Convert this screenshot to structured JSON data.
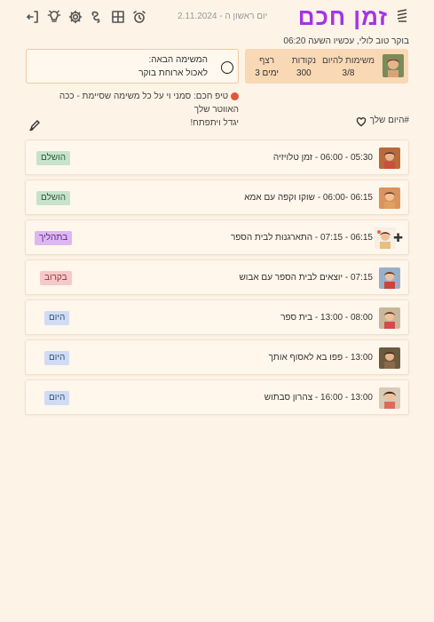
{
  "header": {
    "logo": "זמן חכם",
    "date": "יום ראשון ה - 2.11.2024",
    "greeting": "בוקר טוב לולי, עכשיו השעה 06:20",
    "icons": [
      "logout-icon",
      "lightbulb-icon",
      "gear-icon",
      "puzzle-icon",
      "grid-icon",
      "alarm-clock-icon"
    ]
  },
  "stats": {
    "tasks_label": "משימות להיום",
    "tasks_value": "3/8",
    "points_label": "נקודות",
    "points_value": "300",
    "streak_label": "רצף",
    "streak_value": "3 ימים"
  },
  "next_task": {
    "label": "המשימה הבאה:",
    "value": "לאכול ארוחת בוקר"
  },
  "tip": {
    "line1": "טיפ חכם: סמני וי על כל משימה שסיימת - ככה האווטר שלך",
    "line2": "יגדל ויתפתח!"
  },
  "day": {
    "title": "#היום שלך"
  },
  "tasks": [
    {
      "title": "05:30 - 06:00 - זמן טלויזיה",
      "status": "הושלם"
    },
    {
      "title": "06:15 -06:00 - שוקו וקפה עם אמא",
      "status": "הושלם"
    },
    {
      "title": "06:15 - 07:15 - התארגנות לבית הספר",
      "status": "בתהליך"
    },
    {
      "title": "07:15 - יוצאים לבית הספר עם אבוש",
      "status": "בקרוב"
    },
    {
      "title": "08:00 - 13:00 - בית ספר",
      "status": "היום"
    },
    {
      "title": "13:00 - פפו בא לאסוף אותך",
      "status": "היום"
    },
    {
      "title": "13:00 - 16:00 - צהרון סבתוש",
      "status": "היום"
    }
  ],
  "colors": {
    "accent": "#a333e8",
    "background": "#fdf3e6",
    "stats_bg": "#f8d8b5"
  }
}
